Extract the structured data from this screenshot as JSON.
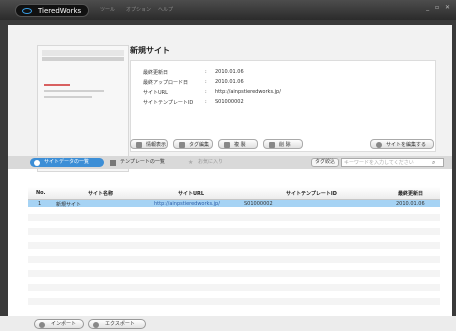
{
  "app": {
    "title": "TieredWorks",
    "menu": [
      "ツール",
      "オプション",
      "ヘルプ"
    ],
    "window_controls": "_ ▫ ✕"
  },
  "site": {
    "title": "新規サイト",
    "fields": [
      {
        "label": "最終更新日",
        "value": "2010.01.06"
      },
      {
        "label": "最終アップロード日",
        "value": "2010.01.06"
      },
      {
        "label": "サイトURL",
        "value": "http://ainpstieredworks.jp/"
      },
      {
        "label": "サイトテンプレートID",
        "value": "S01000002"
      }
    ]
  },
  "actions": {
    "info": "情報表示",
    "tag_edit": "タグ編集",
    "copy": "複 製",
    "delete": "削 除",
    "edit_site": "サイトを編集する"
  },
  "tabs": {
    "site_list": "サイトデータの一覧",
    "template_list": "テンプレートの一覧",
    "favorites": "お気に入り"
  },
  "search": {
    "tag_button": "タグ絞込",
    "placeholder": "キーワードを入力してください"
  },
  "table": {
    "headers": {
      "no": "No.",
      "name": "サイト名称",
      "url": "サイトURL",
      "template_id": "サイトテンプレートID",
      "updated": "最終更新日"
    },
    "rows": [
      {
        "no": "1",
        "name": "新規サイト",
        "url": "http://ainpstieredworks.jp/",
        "template_id": "S01000002",
        "updated": "2010.01.06"
      }
    ]
  },
  "bottom": {
    "import": "インポート",
    "export": "エクスポート"
  },
  "colors": {
    "accent": "#3c8ed6",
    "selected_row": "#a6d3f4",
    "titlebar": "#2b2b2b"
  }
}
